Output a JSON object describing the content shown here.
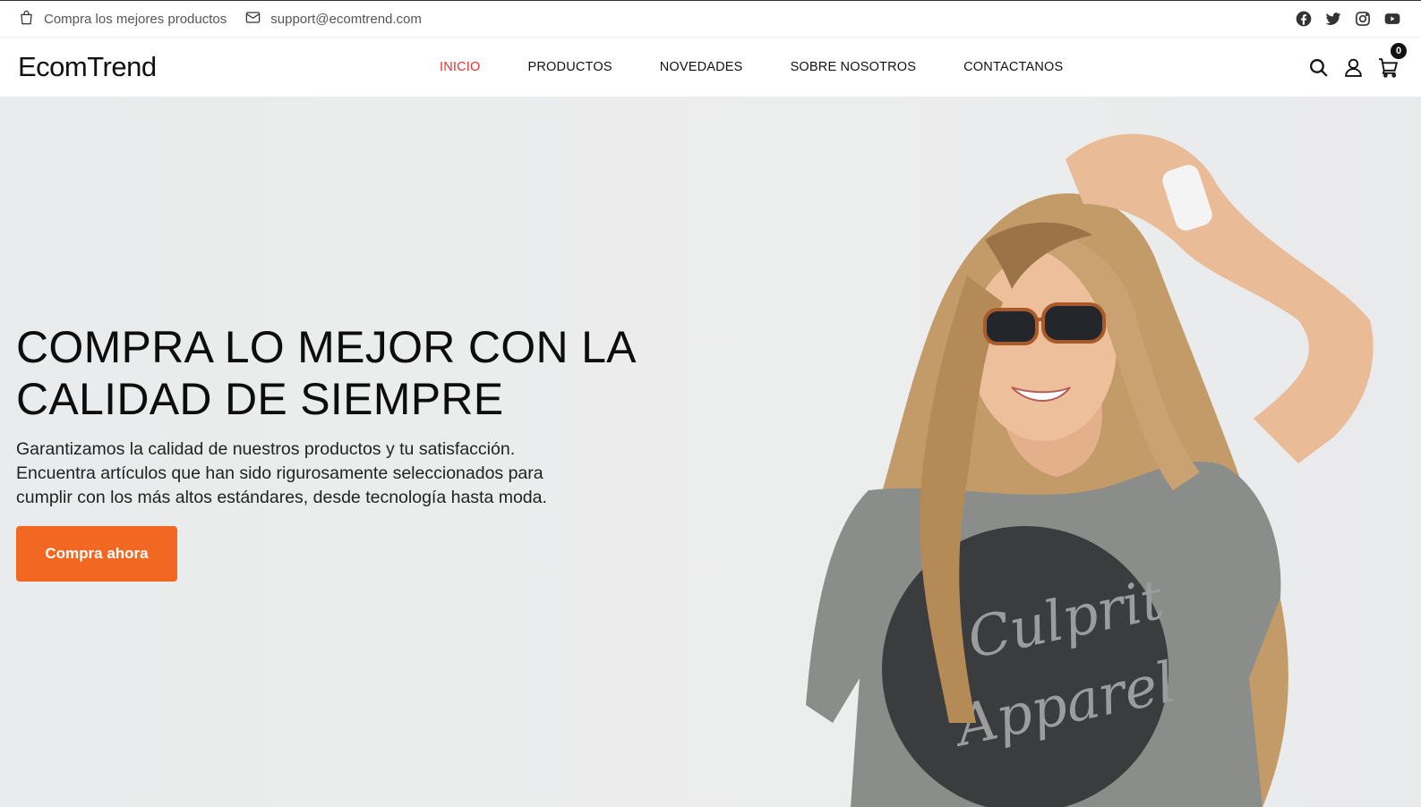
{
  "topbar": {
    "shop_text": "Compra los mejores productos",
    "email": "support@ecomtrend.com",
    "social": [
      "facebook-icon",
      "twitter-icon",
      "instagram-icon",
      "youtube-icon"
    ]
  },
  "header": {
    "logo": "EcomTrend",
    "nav": [
      {
        "label": "INICIO",
        "active": true
      },
      {
        "label": "PRODUCTOS",
        "active": false
      },
      {
        "label": "NOVEDADES",
        "active": false
      },
      {
        "label": "SOBRE NOSOTROS",
        "active": false
      },
      {
        "label": "CONTACTANOS",
        "active": false
      }
    ],
    "cart_count": "0"
  },
  "hero": {
    "title_line1": "COMPRA LO MEJOR CON LA",
    "title_line2": "CALIDAD DE SIEMPRE",
    "text": "Garantizamos la calidad de nuestros productos y tu satisfacción. Encuentra artículos que han sido rigurosamente seleccionados para cumplir con los más altos estándares, desde tecnología hasta moda.",
    "cta_label": "Compra ahora",
    "shirt_line1": "Culprit",
    "shirt_line2": "Apparel"
  },
  "colors": {
    "accent": "#f26722",
    "nav_active": "#ea3030",
    "hero_bg": "#ebeced"
  }
}
